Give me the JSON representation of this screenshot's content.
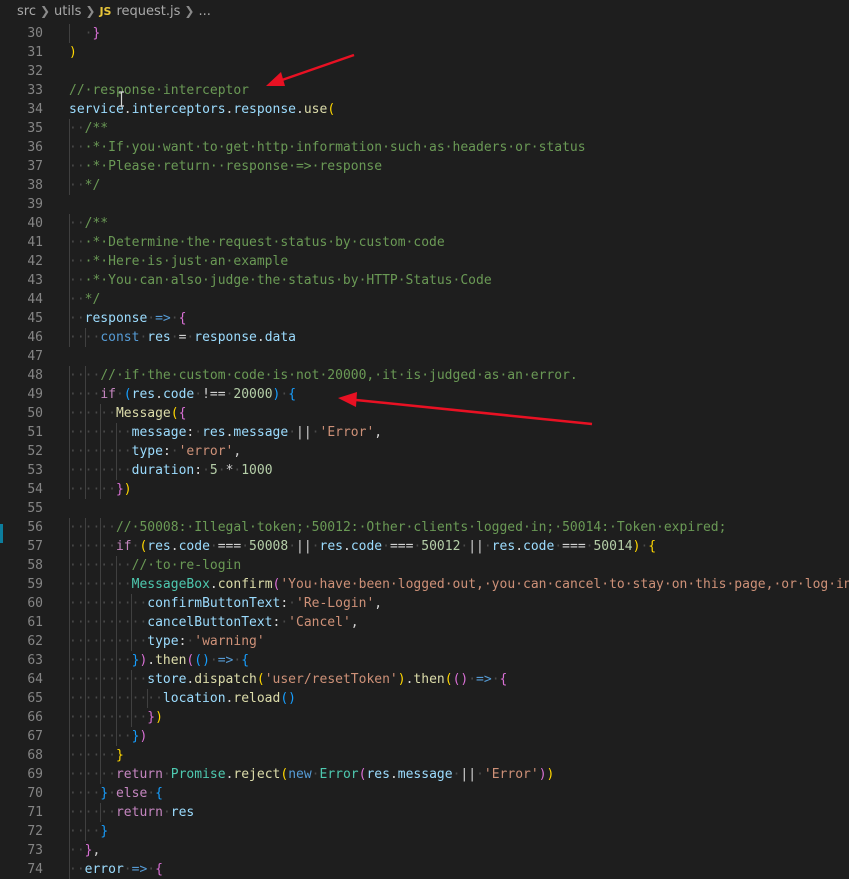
{
  "breadcrumb": {
    "parts": [
      "src",
      "utils"
    ],
    "file_badge": "JS",
    "file": "request.js",
    "more": "..."
  },
  "colors": {
    "background": "#1e1e1e",
    "comment": "#6a9955",
    "keyword": "#569cd6",
    "control": "#c586c0",
    "string": "#ce9178",
    "number": "#b5cea8",
    "variable": "#9cdcfe",
    "function": "#dcdcaa",
    "annotation_arrow": "#e81123"
  },
  "editor": {
    "lines": [
      {
        "num": "30",
        "tokens": [
          [
            "ws",
            "  ·"
          ],
          [
            "b2",
            "}"
          ]
        ]
      },
      {
        "num": "31",
        "tokens": [
          [
            "b1",
            ")"
          ]
        ]
      },
      {
        "num": "32",
        "tokens": []
      },
      {
        "num": "33",
        "tokens": [
          [
            "c",
            "//·response·interceptor"
          ]
        ]
      },
      {
        "num": "34",
        "tokens": [
          [
            "v",
            "service"
          ],
          [
            "p",
            "."
          ],
          [
            "v",
            "interceptors"
          ],
          [
            "p",
            "."
          ],
          [
            "v",
            "response"
          ],
          [
            "p",
            "."
          ],
          [
            "f",
            "use"
          ],
          [
            "b1",
            "("
          ]
        ]
      },
      {
        "num": "35",
        "tokens": [
          [
            "ws",
            "··"
          ],
          [
            "c",
            "/**"
          ]
        ]
      },
      {
        "num": "36",
        "tokens": [
          [
            "ws",
            "··"
          ],
          [
            "c",
            "·*·If·you·want·to·get·http·information·such·as·headers·or·status"
          ]
        ]
      },
      {
        "num": "37",
        "tokens": [
          [
            "ws",
            "··"
          ],
          [
            "c",
            "·*·Please·return··response·=>·response"
          ]
        ]
      },
      {
        "num": "38",
        "tokens": [
          [
            "ws",
            "··"
          ],
          [
            "c",
            "*/"
          ]
        ]
      },
      {
        "num": "39",
        "tokens": []
      },
      {
        "num": "40",
        "tokens": [
          [
            "ws",
            "··"
          ],
          [
            "c",
            "/**"
          ]
        ]
      },
      {
        "num": "41",
        "tokens": [
          [
            "ws",
            "··"
          ],
          [
            "c",
            "·*·Determine·the·request·status·by·custom·code"
          ]
        ]
      },
      {
        "num": "42",
        "tokens": [
          [
            "ws",
            "··"
          ],
          [
            "c",
            "·*·Here·is·just·an·example"
          ]
        ]
      },
      {
        "num": "43",
        "tokens": [
          [
            "ws",
            "··"
          ],
          [
            "c",
            "·*·You·can·also·judge·the·status·by·HTTP·Status·Code"
          ]
        ]
      },
      {
        "num": "44",
        "tokens": [
          [
            "ws",
            "··"
          ],
          [
            "c",
            "*/"
          ]
        ]
      },
      {
        "num": "45",
        "tokens": [
          [
            "ws",
            "··"
          ],
          [
            "v",
            "response"
          ],
          [
            "ws",
            "·"
          ],
          [
            "k",
            "=>"
          ],
          [
            "ws",
            "·"
          ],
          [
            "b2",
            "{"
          ]
        ]
      },
      {
        "num": "46",
        "tokens": [
          [
            "ws",
            "····"
          ],
          [
            "k",
            "const"
          ],
          [
            "ws",
            "·"
          ],
          [
            "v",
            "res"
          ],
          [
            "ws",
            "·"
          ],
          [
            "p",
            "="
          ],
          [
            "ws",
            "·"
          ],
          [
            "v",
            "response"
          ],
          [
            "p",
            "."
          ],
          [
            "v",
            "data"
          ]
        ]
      },
      {
        "num": "47",
        "tokens": []
      },
      {
        "num": "48",
        "tokens": [
          [
            "ws",
            "····"
          ],
          [
            "c",
            "//·if·the·custom·code·is·not·20000,·it·is·judged·as·an·error."
          ]
        ]
      },
      {
        "num": "49",
        "tokens": [
          [
            "ws",
            "····"
          ],
          [
            "ck",
            "if"
          ],
          [
            "ws",
            "·"
          ],
          [
            "b3",
            "("
          ],
          [
            "v",
            "res"
          ],
          [
            "p",
            "."
          ],
          [
            "v",
            "code"
          ],
          [
            "ws",
            "·"
          ],
          [
            "p",
            "!=="
          ],
          [
            "ws",
            "·"
          ],
          [
            "n",
            "20000"
          ],
          [
            "b3",
            ")"
          ],
          [
            "ws",
            "·"
          ],
          [
            "b3",
            "{"
          ]
        ]
      },
      {
        "num": "50",
        "tokens": [
          [
            "ws",
            "······"
          ],
          [
            "f",
            "Message"
          ],
          [
            "b1",
            "("
          ],
          [
            "b2",
            "{"
          ]
        ]
      },
      {
        "num": "51",
        "tokens": [
          [
            "ws",
            "········"
          ],
          [
            "v",
            "message"
          ],
          [
            "p",
            ":"
          ],
          [
            "ws",
            "·"
          ],
          [
            "v",
            "res"
          ],
          [
            "p",
            "."
          ],
          [
            "v",
            "message"
          ],
          [
            "ws",
            "·"
          ],
          [
            "p",
            "||"
          ],
          [
            "ws",
            "·"
          ],
          [
            "s",
            "'Error'"
          ],
          [
            "p",
            ","
          ]
        ]
      },
      {
        "num": "52",
        "tokens": [
          [
            "ws",
            "········"
          ],
          [
            "v",
            "type"
          ],
          [
            "p",
            ":"
          ],
          [
            "ws",
            "·"
          ],
          [
            "s",
            "'error'"
          ],
          [
            "p",
            ","
          ]
        ]
      },
      {
        "num": "53",
        "tokens": [
          [
            "ws",
            "········"
          ],
          [
            "v",
            "duration"
          ],
          [
            "p",
            ":"
          ],
          [
            "ws",
            "·"
          ],
          [
            "n",
            "5"
          ],
          [
            "ws",
            "·"
          ],
          [
            "p",
            "*"
          ],
          [
            "ws",
            "·"
          ],
          [
            "n",
            "1000"
          ]
        ]
      },
      {
        "num": "54",
        "tokens": [
          [
            "ws",
            "······"
          ],
          [
            "b2",
            "}"
          ],
          [
            "b1",
            ")"
          ]
        ]
      },
      {
        "num": "55",
        "tokens": []
      },
      {
        "num": "56",
        "tokens": [
          [
            "ws",
            "······"
          ],
          [
            "c",
            "//·50008:·Illegal·token;·50012:·Other·clients·logged·in;·50014:·Token·expired;"
          ]
        ]
      },
      {
        "num": "57",
        "tokens": [
          [
            "ws",
            "······"
          ],
          [
            "ck",
            "if"
          ],
          [
            "ws",
            "·"
          ],
          [
            "b1",
            "("
          ],
          [
            "v",
            "res"
          ],
          [
            "p",
            "."
          ],
          [
            "v",
            "code"
          ],
          [
            "ws",
            "·"
          ],
          [
            "p",
            "==="
          ],
          [
            "ws",
            "·"
          ],
          [
            "n",
            "50008"
          ],
          [
            "ws",
            "·"
          ],
          [
            "p",
            "||"
          ],
          [
            "ws",
            "·"
          ],
          [
            "v",
            "res"
          ],
          [
            "p",
            "."
          ],
          [
            "v",
            "code"
          ],
          [
            "ws",
            "·"
          ],
          [
            "p",
            "==="
          ],
          [
            "ws",
            "·"
          ],
          [
            "n",
            "50012"
          ],
          [
            "ws",
            "·"
          ],
          [
            "p",
            "||"
          ],
          [
            "ws",
            "·"
          ],
          [
            "v",
            "res"
          ],
          [
            "p",
            "."
          ],
          [
            "v",
            "code"
          ],
          [
            "ws",
            "·"
          ],
          [
            "p",
            "==="
          ],
          [
            "ws",
            "·"
          ],
          [
            "n",
            "50014"
          ],
          [
            "b1",
            ")"
          ],
          [
            "ws",
            "·"
          ],
          [
            "b1",
            "{"
          ]
        ]
      },
      {
        "num": "58",
        "tokens": [
          [
            "ws",
            "········"
          ],
          [
            "c",
            "//·to·re-login"
          ]
        ]
      },
      {
        "num": "59",
        "tokens": [
          [
            "ws",
            "········"
          ],
          [
            "t",
            "MessageBox"
          ],
          [
            "p",
            "."
          ],
          [
            "f",
            "confirm"
          ],
          [
            "b2",
            "("
          ],
          [
            "s",
            "'You·have·been·logged·out,·you·can·cancel·to·stay·on·this·page,·or·log·in·a"
          ]
        ]
      },
      {
        "num": "60",
        "tokens": [
          [
            "ws",
            "··········"
          ],
          [
            "v",
            "confirmButtonText"
          ],
          [
            "p",
            ":"
          ],
          [
            "ws",
            "·"
          ],
          [
            "s",
            "'Re-Login'"
          ],
          [
            "p",
            ","
          ]
        ]
      },
      {
        "num": "61",
        "tokens": [
          [
            "ws",
            "··········"
          ],
          [
            "v",
            "cancelButtonText"
          ],
          [
            "p",
            ":"
          ],
          [
            "ws",
            "·"
          ],
          [
            "s",
            "'Cancel'"
          ],
          [
            "p",
            ","
          ]
        ]
      },
      {
        "num": "62",
        "tokens": [
          [
            "ws",
            "··········"
          ],
          [
            "v",
            "type"
          ],
          [
            "p",
            ":"
          ],
          [
            "ws",
            "·"
          ],
          [
            "s",
            "'warning'"
          ]
        ]
      },
      {
        "num": "63",
        "tokens": [
          [
            "ws",
            "········"
          ],
          [
            "b3",
            "}"
          ],
          [
            "b2",
            ")"
          ],
          [
            "p",
            "."
          ],
          [
            "f",
            "then"
          ],
          [
            "b2",
            "("
          ],
          [
            "b3",
            "()"
          ],
          [
            "ws",
            "·"
          ],
          [
            "k",
            "=>"
          ],
          [
            "ws",
            "·"
          ],
          [
            "b3",
            "{"
          ]
        ]
      },
      {
        "num": "64",
        "tokens": [
          [
            "ws",
            "··········"
          ],
          [
            "v",
            "store"
          ],
          [
            "p",
            "."
          ],
          [
            "f",
            "dispatch"
          ],
          [
            "b1",
            "("
          ],
          [
            "s",
            "'user/resetToken'"
          ],
          [
            "b1",
            ")"
          ],
          [
            "p",
            "."
          ],
          [
            "f",
            "then"
          ],
          [
            "b1",
            "("
          ],
          [
            "b2",
            "()"
          ],
          [
            "ws",
            "·"
          ],
          [
            "k",
            "=>"
          ],
          [
            "ws",
            "·"
          ],
          [
            "b2",
            "{"
          ]
        ]
      },
      {
        "num": "65",
        "tokens": [
          [
            "ws",
            "············"
          ],
          [
            "v",
            "location"
          ],
          [
            "p",
            "."
          ],
          [
            "f",
            "reload"
          ],
          [
            "b3",
            "()"
          ]
        ]
      },
      {
        "num": "66",
        "tokens": [
          [
            "ws",
            "··········"
          ],
          [
            "b2",
            "}"
          ],
          [
            "b1",
            ")"
          ]
        ]
      },
      {
        "num": "67",
        "tokens": [
          [
            "ws",
            "········"
          ],
          [
            "b3",
            "}"
          ],
          [
            "b2",
            ")"
          ]
        ]
      },
      {
        "num": "68",
        "tokens": [
          [
            "ws",
            "······"
          ],
          [
            "b1",
            "}"
          ]
        ]
      },
      {
        "num": "69",
        "tokens": [
          [
            "ws",
            "······"
          ],
          [
            "ck",
            "return"
          ],
          [
            "ws",
            "·"
          ],
          [
            "t",
            "Promise"
          ],
          [
            "p",
            "."
          ],
          [
            "f",
            "reject"
          ],
          [
            "b1",
            "("
          ],
          [
            "k",
            "new"
          ],
          [
            "ws",
            "·"
          ],
          [
            "t",
            "Error"
          ],
          [
            "b2",
            "("
          ],
          [
            "v",
            "res"
          ],
          [
            "p",
            "."
          ],
          [
            "v",
            "message"
          ],
          [
            "ws",
            "·"
          ],
          [
            "p",
            "||"
          ],
          [
            "ws",
            "·"
          ],
          [
            "s",
            "'Error'"
          ],
          [
            "b2",
            ")"
          ],
          [
            "b1",
            ")"
          ]
        ]
      },
      {
        "num": "70",
        "tokens": [
          [
            "ws",
            "····"
          ],
          [
            "b3",
            "}"
          ],
          [
            "ws",
            "·"
          ],
          [
            "ck",
            "else"
          ],
          [
            "ws",
            "·"
          ],
          [
            "b3",
            "{"
          ]
        ]
      },
      {
        "num": "71",
        "tokens": [
          [
            "ws",
            "······"
          ],
          [
            "ck",
            "return"
          ],
          [
            "ws",
            "·"
          ],
          [
            "v",
            "res"
          ]
        ]
      },
      {
        "num": "72",
        "tokens": [
          [
            "ws",
            "····"
          ],
          [
            "b3",
            "}"
          ]
        ]
      },
      {
        "num": "73",
        "tokens": [
          [
            "ws",
            "··"
          ],
          [
            "b2",
            "}"
          ],
          [
            "p",
            ","
          ]
        ]
      },
      {
        "num": "74",
        "tokens": [
          [
            "ws",
            "··"
          ],
          [
            "v",
            "error"
          ],
          [
            "ws",
            "·"
          ],
          [
            "k",
            "=>"
          ],
          [
            "ws",
            "·"
          ],
          [
            "b2",
            "{"
          ]
        ]
      }
    ]
  }
}
